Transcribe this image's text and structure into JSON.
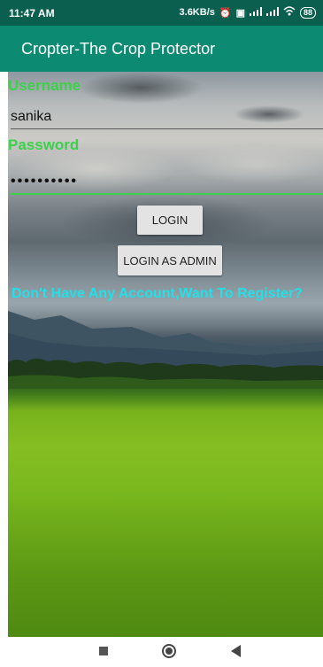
{
  "status_bar": {
    "time": "11:47 AM",
    "network_speed": "3.6KB/s",
    "battery": "88",
    "icons": [
      "alarm-icon",
      "sim-icon",
      "signal-icon",
      "signal-icon",
      "wifi-icon",
      "battery-icon"
    ]
  },
  "app_bar": {
    "title": "Cropter-The Crop Protector"
  },
  "form": {
    "username_label": "Username",
    "username_value": "sanika",
    "password_label": "Password",
    "password_value": "••••••••••",
    "login_button": "LOGIN",
    "admin_button": "LOGIN AS ADMIN",
    "register_link": "Don't Have Any Account,Want To Register?"
  },
  "colors": {
    "status_bar": "#0a5f4f",
    "app_bar": "#0d8a72",
    "label_green": "#3bd14a",
    "register_cyan": "#22e0e8"
  },
  "nav_bar": {
    "icons": [
      "recent-apps-icon",
      "home-icon",
      "back-icon"
    ]
  }
}
